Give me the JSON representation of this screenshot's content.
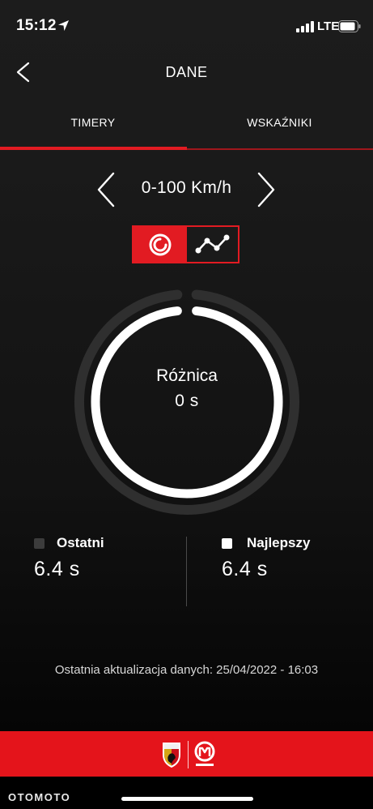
{
  "status_bar": {
    "time": "15:12",
    "network": "LTE"
  },
  "header": {
    "title": "DANE"
  },
  "tabs": [
    {
      "label": "TIMERY",
      "active": true
    },
    {
      "label": "WSKAŹNIKI",
      "active": false
    }
  ],
  "selector": {
    "label": "0-100 Km/h"
  },
  "view_toggle": {
    "options": [
      "timer-icon",
      "chart-line-icon"
    ],
    "selected": "timer-icon"
  },
  "ring": {
    "title": "Różnica",
    "value": "0 s"
  },
  "stats": {
    "last": {
      "label": "Ostatni",
      "value": "6.4 s"
    },
    "best": {
      "label": "Najlepszy",
      "value": "6.4 s"
    }
  },
  "last_update": "Ostatnia aktualizacja danych: 25/04/2022 - 16:03",
  "footer": {
    "logos": [
      "abarth-logo",
      "mopar-logo"
    ]
  },
  "watermark": "OTOMOTO",
  "colors": {
    "accent": "#e21b22",
    "background": "#1a1a1a"
  }
}
